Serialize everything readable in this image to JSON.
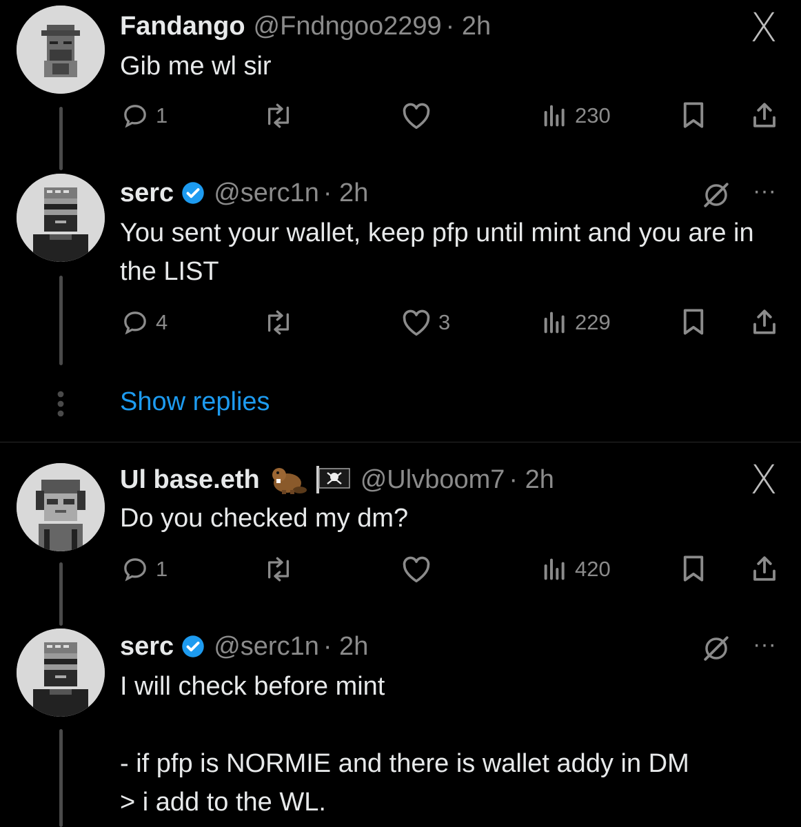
{
  "colors": {
    "background": "#000000",
    "text": "#e7e9ea",
    "muted": "#8b8b8b",
    "link": "#1d9bf0",
    "verified": "#1d9bf0"
  },
  "tweets": [
    {
      "display_name": "Fandango",
      "handle": "@Fndngoo2299",
      "time": "· 2h",
      "text": "Gib me wl sir",
      "replies": "1",
      "retweets": "",
      "likes": "",
      "views": "230",
      "verified": false,
      "corner_icon": "x-icon"
    },
    {
      "display_name": "serc",
      "handle": "@serc1n",
      "time": "· 2h",
      "text": "You sent your wallet, keep pfp until mint and you are in the LIST",
      "replies": "4",
      "retweets": "",
      "likes": "3",
      "views": "229",
      "verified": true,
      "corner_icon": "grok-icon"
    },
    {
      "display_name": "Ul base.eth",
      "handle": "@Ulvboom7",
      "time": "· 2h",
      "text": "Do you checked my dm?",
      "replies": "1",
      "retweets": "",
      "likes": "",
      "views": "420",
      "verified": false,
      "corner_icon": "x-icon"
    },
    {
      "display_name": "serc",
      "handle": "@serc1n",
      "time": "· 2h",
      "text": "I will check before mint",
      "text_line2": "- if pfp is NORMIE and there is wallet addy in DM",
      "text_line3": "> i add to the WL.",
      "verified": true,
      "corner_icon": "grok-icon"
    }
  ],
  "show_replies": "Show replies",
  "close_glyph": "X",
  "more_glyph": "···"
}
